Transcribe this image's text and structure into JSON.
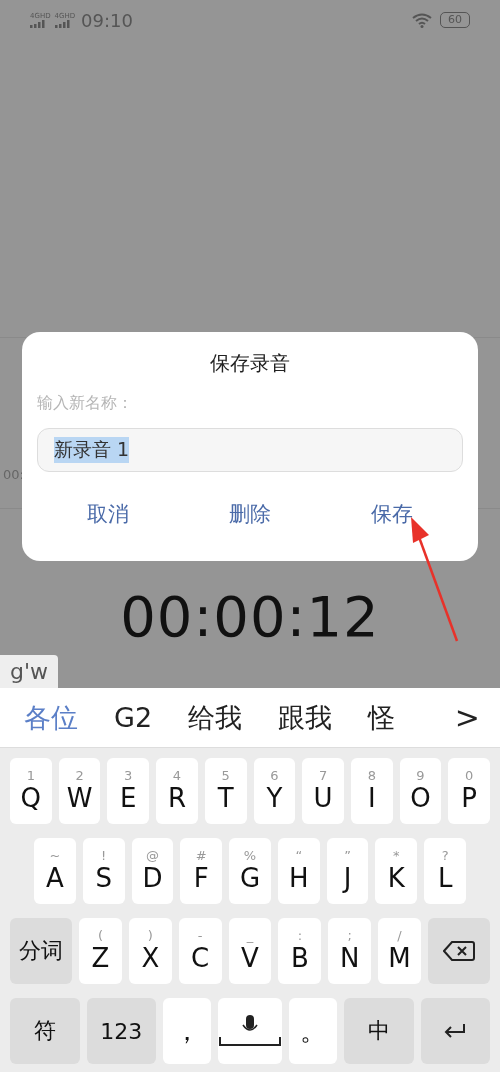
{
  "status_bar": {
    "networks": [
      "4GHD",
      "4GHD"
    ],
    "time": "09:10",
    "battery": "60"
  },
  "background": {
    "timeline_label": "00:"
  },
  "dialog": {
    "title": "保存录音",
    "prompt": "输入新名称：",
    "field": {
      "value": "新录音 1",
      "selected": true
    },
    "buttons": [
      {
        "label": "取消"
      },
      {
        "label": "删除"
      },
      {
        "label": "保存"
      }
    ]
  },
  "timer": "00:00:12",
  "keyboard": {
    "composition": "g'w",
    "candidates": [
      {
        "label": "各位",
        "selected": true
      },
      {
        "label": "G2",
        "selected": false
      },
      {
        "label": "给我",
        "selected": false
      },
      {
        "label": "跟我",
        "selected": false
      },
      {
        "label": "怪",
        "selected": false
      }
    ],
    "more": ">",
    "rows": [
      [
        {
          "kind": "letter",
          "label": "Q",
          "hint": "1"
        },
        {
          "kind": "letter",
          "label": "W",
          "hint": "2"
        },
        {
          "kind": "letter",
          "label": "E",
          "hint": "3"
        },
        {
          "kind": "letter",
          "label": "R",
          "hint": "4"
        },
        {
          "kind": "letter",
          "label": "T",
          "hint": "5"
        },
        {
          "kind": "letter",
          "label": "Y",
          "hint": "6"
        },
        {
          "kind": "letter",
          "label": "U",
          "hint": "7"
        },
        {
          "kind": "letter",
          "label": "I",
          "hint": "8"
        },
        {
          "kind": "letter",
          "label": "O",
          "hint": "9"
        },
        {
          "kind": "letter",
          "label": "P",
          "hint": "0"
        }
      ],
      [
        {
          "kind": "letter",
          "label": "A",
          "hint": "~"
        },
        {
          "kind": "letter",
          "label": "S",
          "hint": "!"
        },
        {
          "kind": "letter",
          "label": "D",
          "hint": "@"
        },
        {
          "kind": "letter",
          "label": "F",
          "hint": "#"
        },
        {
          "kind": "letter",
          "label": "G",
          "hint": "%"
        },
        {
          "kind": "letter",
          "label": "H",
          "hint": "“"
        },
        {
          "kind": "letter",
          "label": "J",
          "hint": "”"
        },
        {
          "kind": "letter",
          "label": "K",
          "hint": "*"
        },
        {
          "kind": "letter",
          "label": "L",
          "hint": "?"
        }
      ],
      [
        {
          "kind": "function",
          "label": "分词"
        },
        {
          "kind": "letter",
          "label": "Z",
          "hint": "("
        },
        {
          "kind": "letter",
          "label": "X",
          "hint": ")"
        },
        {
          "kind": "letter",
          "label": "C",
          "hint": "-"
        },
        {
          "kind": "letter",
          "label": "V",
          "hint": "_"
        },
        {
          "kind": "letter",
          "label": "B",
          "hint": ":"
        },
        {
          "kind": "letter",
          "label": "N",
          "hint": ";"
        },
        {
          "kind": "letter",
          "label": "M",
          "hint": "/"
        },
        {
          "kind": "backspace"
        }
      ],
      [
        {
          "kind": "function",
          "label": "符"
        },
        {
          "kind": "function",
          "label": "123"
        },
        {
          "kind": "letter",
          "label": "，"
        },
        {
          "kind": "space"
        },
        {
          "kind": "letter",
          "label": "。"
        },
        {
          "kind": "function",
          "label": "中"
        },
        {
          "kind": "return"
        }
      ]
    ]
  }
}
